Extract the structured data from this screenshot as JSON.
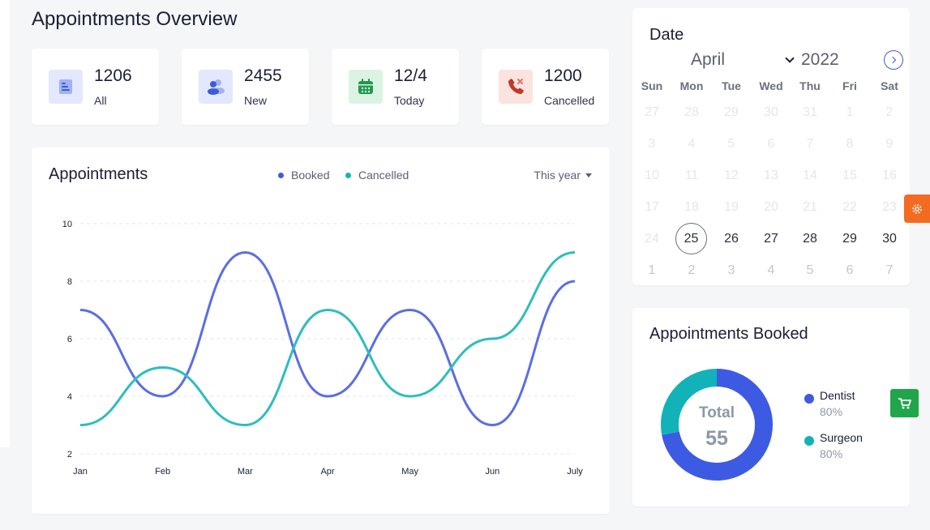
{
  "page": {
    "title": "Appointments Overview"
  },
  "stats": [
    {
      "value": "1206",
      "label": "All",
      "icon": "document-list-icon",
      "icon_color": "#3f5bd8",
      "icon_bg": "#e4e8fc"
    },
    {
      "value": "2455",
      "label": "New",
      "icon": "users-icon",
      "icon_color": "#3f5bd8",
      "icon_bg": "#e4e8fc"
    },
    {
      "value": "12/4",
      "label": "Today",
      "icon": "calendar-icon",
      "icon_color": "#1f9a4b",
      "icon_bg": "#dcf3e4"
    },
    {
      "value": "1200",
      "label": "Cancelled",
      "icon": "phone-cancel-icon",
      "icon_color": "#c0392b",
      "icon_bg": "#fbe3df"
    }
  ],
  "appointments_chart": {
    "title": "Appointments",
    "period": "This year",
    "legend": [
      {
        "name": "Booked",
        "color": "#3f5bd8"
      },
      {
        "name": "Cancelled",
        "color": "#12b3b8"
      }
    ]
  },
  "chart_data": {
    "type": "line",
    "title": "Appointments",
    "categories": [
      "Jan",
      "Feb",
      "Mar",
      "Apr",
      "May",
      "Jun",
      "July"
    ],
    "series": [
      {
        "name": "Booked",
        "color": "#5b6ee1",
        "values": [
          7,
          4,
          9,
          4,
          7,
          3,
          8
        ]
      },
      {
        "name": "Cancelled",
        "color": "#2ebdbd",
        "values": [
          3,
          5,
          3,
          7,
          4,
          6,
          9
        ]
      }
    ],
    "ylim": [
      2,
      10
    ],
    "yticks": [
      2,
      4,
      6,
      8,
      10
    ],
    "grid": true,
    "smooth": true,
    "legend_position": "top-right"
  },
  "calendar": {
    "title": "Date",
    "month": "April",
    "year": "2022",
    "weekdays": [
      "Sun",
      "Mon",
      "Tue",
      "Wed",
      "Thu",
      "Fri",
      "Sat"
    ],
    "weeks": [
      [
        "27",
        "28",
        "29",
        "30",
        "31",
        "1",
        "2"
      ],
      [
        "3",
        "4",
        "5",
        "6",
        "7",
        "8",
        "9"
      ],
      [
        "10",
        "11",
        "12",
        "13",
        "14",
        "15",
        "16"
      ],
      [
        "17",
        "18",
        "19",
        "20",
        "21",
        "22",
        "23"
      ],
      [
        "24",
        "25",
        "26",
        "27",
        "28",
        "29",
        "30"
      ],
      [
        "1",
        "2",
        "3",
        "4",
        "5",
        "6",
        "7"
      ]
    ],
    "selected": "25"
  },
  "appointments_booked": {
    "title": "Appointments Booked",
    "total_label": "Total",
    "total_value": "55",
    "segments": [
      {
        "name": "Dentist",
        "percent": "80%",
        "color": "#3d5ae3",
        "share": 0.72
      },
      {
        "name": "Surgeon",
        "percent": "80%",
        "color": "#12b3b8",
        "share": 0.28
      }
    ]
  }
}
